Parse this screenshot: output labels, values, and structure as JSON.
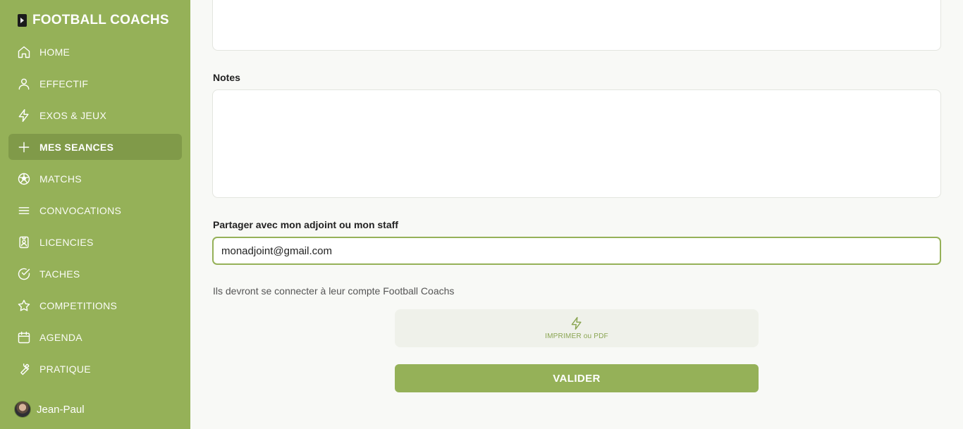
{
  "brand": {
    "title": "FOOTBALL COACHS"
  },
  "sidebar": {
    "items": [
      {
        "label": "HOME",
        "icon": "home-icon"
      },
      {
        "label": "EFFECTIF",
        "icon": "user-icon"
      },
      {
        "label": "EXOS & JEUX",
        "icon": "lightning-icon"
      },
      {
        "label": "MES SEANCES",
        "icon": "plus-icon",
        "active": true
      },
      {
        "label": "MATCHS",
        "icon": "soccer-ball-icon"
      },
      {
        "label": "CONVOCATIONS",
        "icon": "menu-lines-icon"
      },
      {
        "label": "LICENCIES",
        "icon": "id-badge-icon"
      },
      {
        "label": "TACHES",
        "icon": "check-circle-icon"
      },
      {
        "label": "COMPETITIONS",
        "icon": "star-icon"
      },
      {
        "label": "AGENDA",
        "icon": "calendar-icon"
      },
      {
        "label": "PRATIQUE",
        "icon": "wrench-icon"
      }
    ]
  },
  "user": {
    "name": "Jean-Paul"
  },
  "main": {
    "notes_label": "Notes",
    "share_label": "Partager avec mon adjoint ou mon staff",
    "share_value": "monadjoint@gmail.com",
    "hint": "Ils devront se connecter à leur compte Football Coachs",
    "print_label": "IMPRIMER ou PDF",
    "validate_label": "VALIDER"
  },
  "colors": {
    "sidebar_bg": "#95b158",
    "active_item_bg": "#809a49",
    "accent": "#95b158",
    "page_bg": "#f8f9f6"
  }
}
